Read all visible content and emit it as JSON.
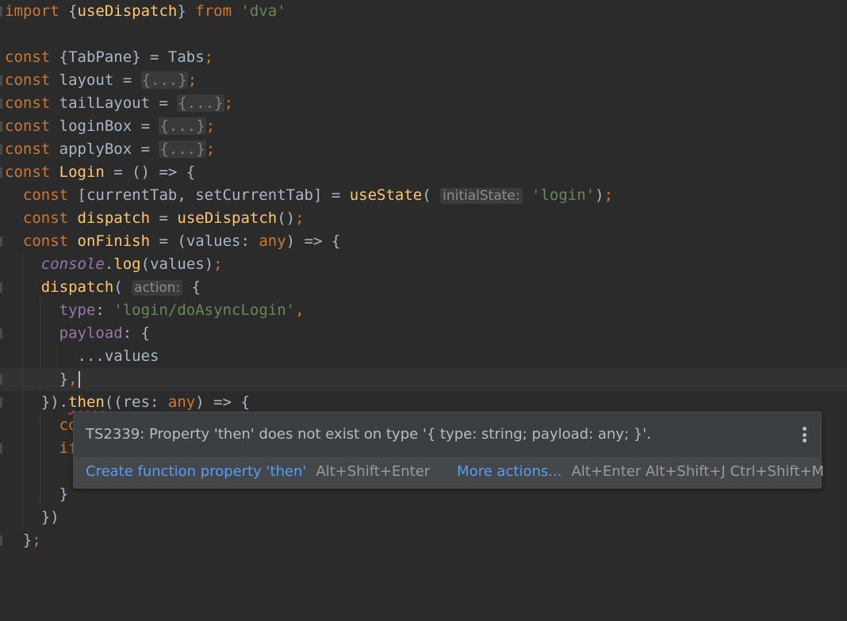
{
  "editor": {
    "hint_initialState": "initialState:",
    "hint_action": "action:"
  },
  "tooltip": {
    "message": "TS2339: Property 'then' does not exist on type '{ type: string; payload: any; }'.",
    "menu_icon": "more-vertical-icon",
    "action_primary": "Create function property 'then'",
    "action_primary_shortcut": "Alt+Shift+Enter",
    "action_more": "More actions...",
    "action_more_shortcut": "Alt+Enter Alt+Shift+J Ctrl+Shift+M"
  },
  "colors": {
    "background": "#2b2b2b",
    "keyword": "#cc7832",
    "function": "#ffc66d",
    "string": "#6a8759",
    "property": "#9876aa",
    "link": "#589df6",
    "error_underline": "#bc3f3c"
  }
}
